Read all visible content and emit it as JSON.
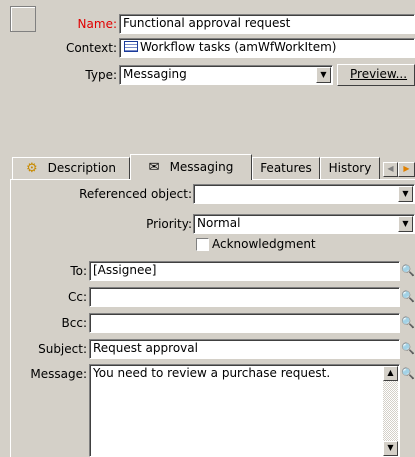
{
  "header": {
    "name_label": "Name:",
    "name_value": "Functional approval request",
    "context_label": "Context:",
    "context_value": "Workflow tasks (amWfWorkItem)",
    "type_label": "Type:",
    "type_value": "Messaging",
    "preview_label": "Preview..."
  },
  "tabs": [
    {
      "label": "Description",
      "icon": "gears-icon"
    },
    {
      "label": "Messaging",
      "icon": "envelope-icon",
      "active": true
    },
    {
      "label": "Features"
    },
    {
      "label": "History"
    }
  ],
  "messaging": {
    "referenced_object_label": "Referenced object:",
    "referenced_object_value": "",
    "priority_label": "Priority:",
    "priority_value": "Normal",
    "acknowledgment_label": "Acknowledgment",
    "acknowledgment_checked": false,
    "to_label": "To:",
    "to_value": "[Assignee]",
    "cc_label": "Cc:",
    "cc_value": "",
    "bcc_label": "Bcc:",
    "bcc_value": "",
    "subject_label": "Subject:",
    "subject_value": "Request approval",
    "message_label": "Message:",
    "message_value": "You need to review a purchase request."
  },
  "colors": {
    "background": "#d4d0c8",
    "required_label": "#e00000"
  }
}
